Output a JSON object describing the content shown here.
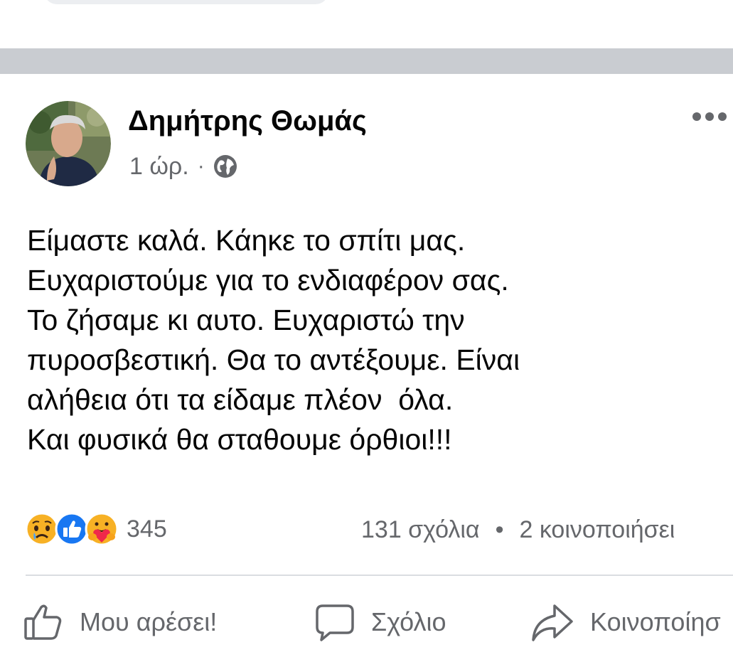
{
  "post": {
    "author": "Δημήτρης Θωμάς",
    "time": "1 ώρ.",
    "separator": "·",
    "audience_icon": "globe-icon",
    "text_lines": [
      "Είμαστε καλά. Κάηκε το σπίτι μας.",
      "Ευχαριστούμε για το ενδιαφέρον σας.",
      "Το ζήσαμε κι αυτο. Ευχαριστώ την",
      "πυροσβεστική. Θα το αντέξουμε. Είναι",
      "αλήθεια ότι τα είδαμε πλέον  όλα.",
      "Και φυσικά θα σταθουμε όρθιοι!!!"
    ]
  },
  "reactions": {
    "icons": [
      "sad-reaction-icon",
      "like-reaction-icon",
      "care-reaction-icon"
    ],
    "count": "345"
  },
  "engagement": {
    "comments": "131 σχόλια",
    "dot": "•",
    "shares": "2 κοινοποιήσει"
  },
  "actions": {
    "like": "Μου αρέσει!",
    "comment": "Σχόλιο",
    "share": "Κοινοποίησ"
  },
  "colors": {
    "text": "#050505",
    "secondary": "#65676b",
    "divider": "#c9ccd1",
    "like_blue": "#1877f2",
    "reaction_yellow": "#f7b125"
  }
}
